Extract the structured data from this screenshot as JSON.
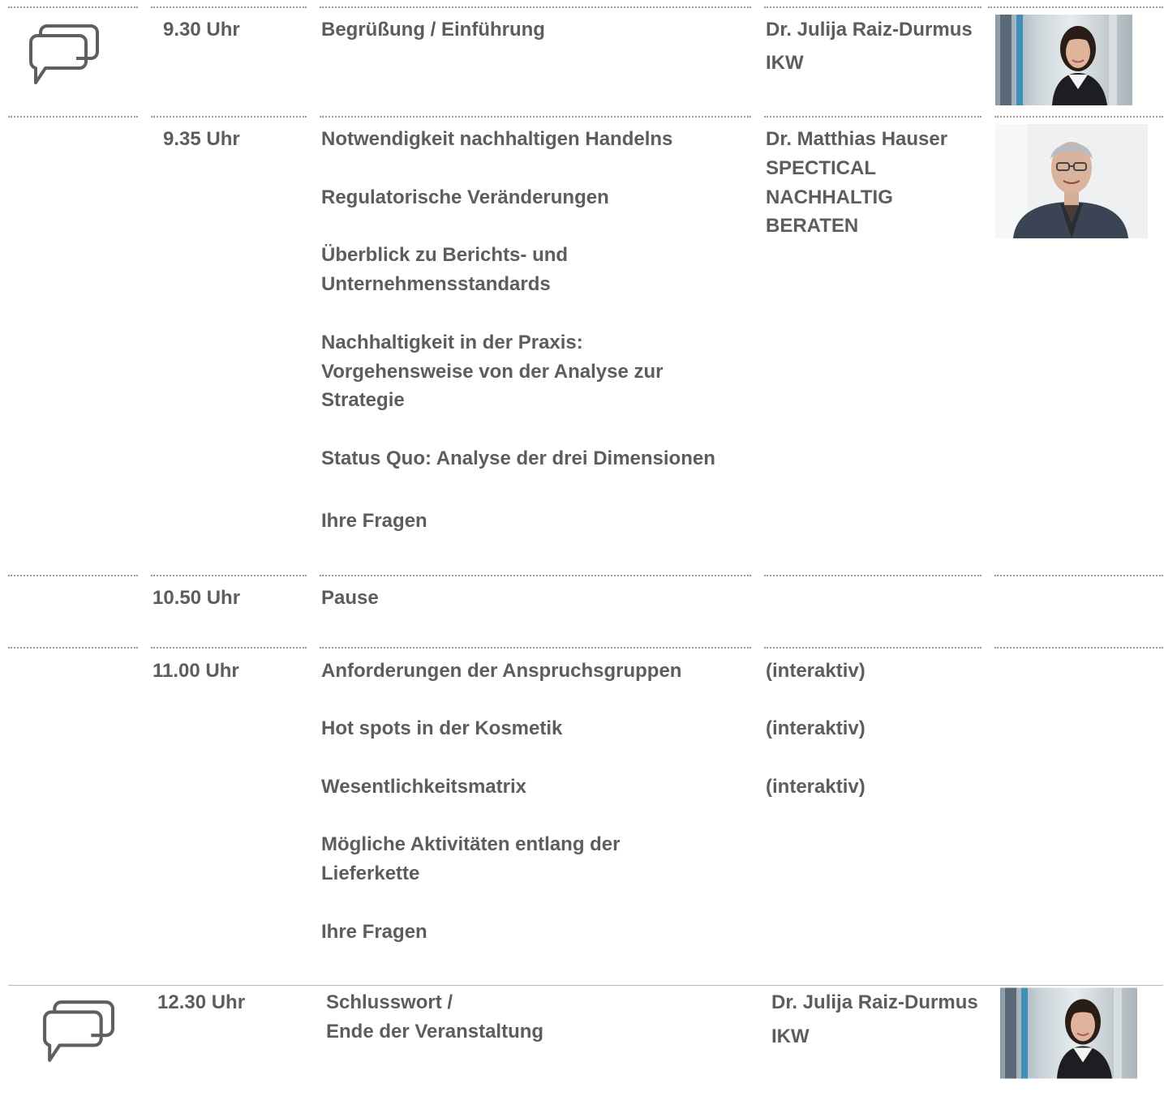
{
  "agenda": [
    {
      "time": "9.30 Uhr",
      "topics": [
        "Begrüßung / Einführung"
      ],
      "speaker": "Dr. Julija Raiz-Durmus",
      "org": "IKW",
      "icon": "chat-bubbles-icon",
      "photo": "speaker-photo-woman"
    },
    {
      "time": "9.35 Uhr",
      "topics": [
        "Notwendigkeit nachhaltigen Handelns",
        "Regulatorische Veränderungen",
        "Überblick zu Berichts- und",
        "Unternehmensstandards",
        "Nachhaltigkeit in der Praxis:",
        "Vorgehensweise von der Analyse zur",
        "Strategie",
        "Status Quo: Analyse der drei Dimensionen",
        "Ihre Fragen"
      ],
      "speaker": "Dr. Matthias Hauser",
      "org_lines": [
        "SPECTICAL",
        "NACHHALTIG",
        "BERATEN"
      ],
      "photo": "speaker-photo-man"
    },
    {
      "time": "10.50 Uhr",
      "topics": [
        "Pause"
      ]
    },
    {
      "time": "11.00 Uhr",
      "topics": [
        "Anforderungen der Anspruchsgruppen",
        "Hot spots in der Kosmetik",
        "Wesentlichkeitsmatrix",
        "Mögliche Aktivitäten entlang der",
        "Lieferkette",
        "Ihre Fragen"
      ],
      "notes": [
        "(interaktiv)",
        "(interaktiv)",
        "(interaktiv)"
      ]
    },
    {
      "time": "12.30 Uhr",
      "topics": [
        "Schlusswort /",
        "Ende der Veranstaltung"
      ],
      "speaker": "Dr. Julija Raiz-Durmus",
      "org": "IKW",
      "icon": "chat-bubbles-icon",
      "photo": "speaker-photo-woman"
    }
  ],
  "colors": {
    "text": "#5d5d5d",
    "rule": "#9a9a9a",
    "icon": "#5f5f5f"
  }
}
